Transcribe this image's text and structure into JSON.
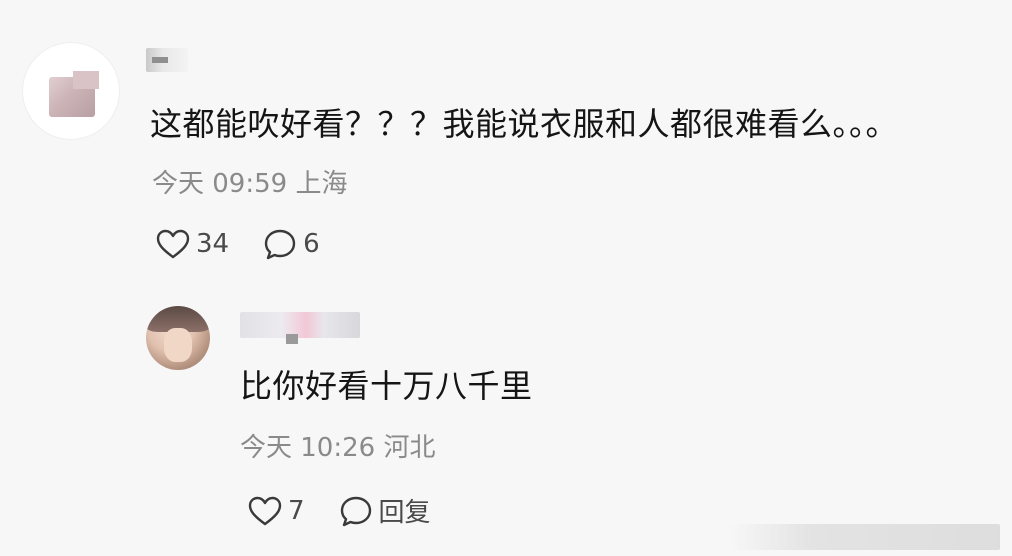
{
  "comments": [
    {
      "text": "这都能吹好看？？？我能说衣服和人都很难看么。。。",
      "time": "今天 09:59",
      "location": "上海",
      "likes": "34",
      "replies": "6"
    },
    {
      "text": "比你好看十万八千里",
      "time": "今天 10:26",
      "location": "河北",
      "likes": "7",
      "reply_label": "回复"
    }
  ],
  "icons": {
    "like": "heart-outline-icon",
    "comment": "speech-bubble-icon"
  },
  "colors": {
    "background": "#f7f7f8",
    "text": "#151515",
    "meta": "#8a8a8a"
  }
}
